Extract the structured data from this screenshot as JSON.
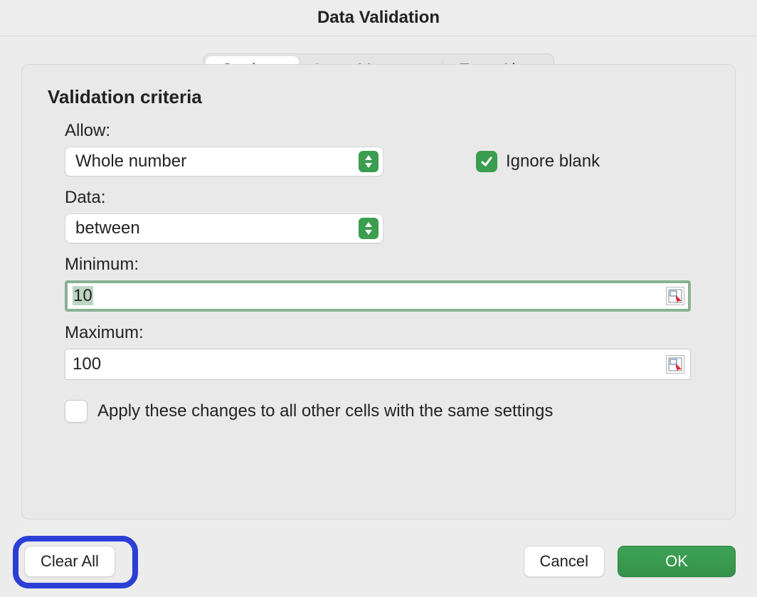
{
  "window": {
    "title": "Data Validation"
  },
  "tabs": {
    "settings": "Settings",
    "input_message": "Input Message",
    "error_alert": "Error Alert",
    "active": "settings"
  },
  "section": {
    "criteria_title": "Validation criteria"
  },
  "allow": {
    "label": "Allow:",
    "value": "Whole number"
  },
  "ignore_blank": {
    "label": "Ignore blank",
    "checked": true
  },
  "data_op": {
    "label": "Data:",
    "value": "between"
  },
  "minimum": {
    "label": "Minimum:",
    "value": "10",
    "focused": true
  },
  "maximum": {
    "label": "Maximum:",
    "value": "100",
    "focused": false
  },
  "apply_all": {
    "label": "Apply these changes to all other cells with the same settings",
    "checked": false
  },
  "buttons": {
    "clear_all": "Clear All",
    "cancel": "Cancel",
    "ok": "OK"
  },
  "colors": {
    "accent_green": "#3a9d4f",
    "highlight_blue": "#2b3fd6"
  }
}
